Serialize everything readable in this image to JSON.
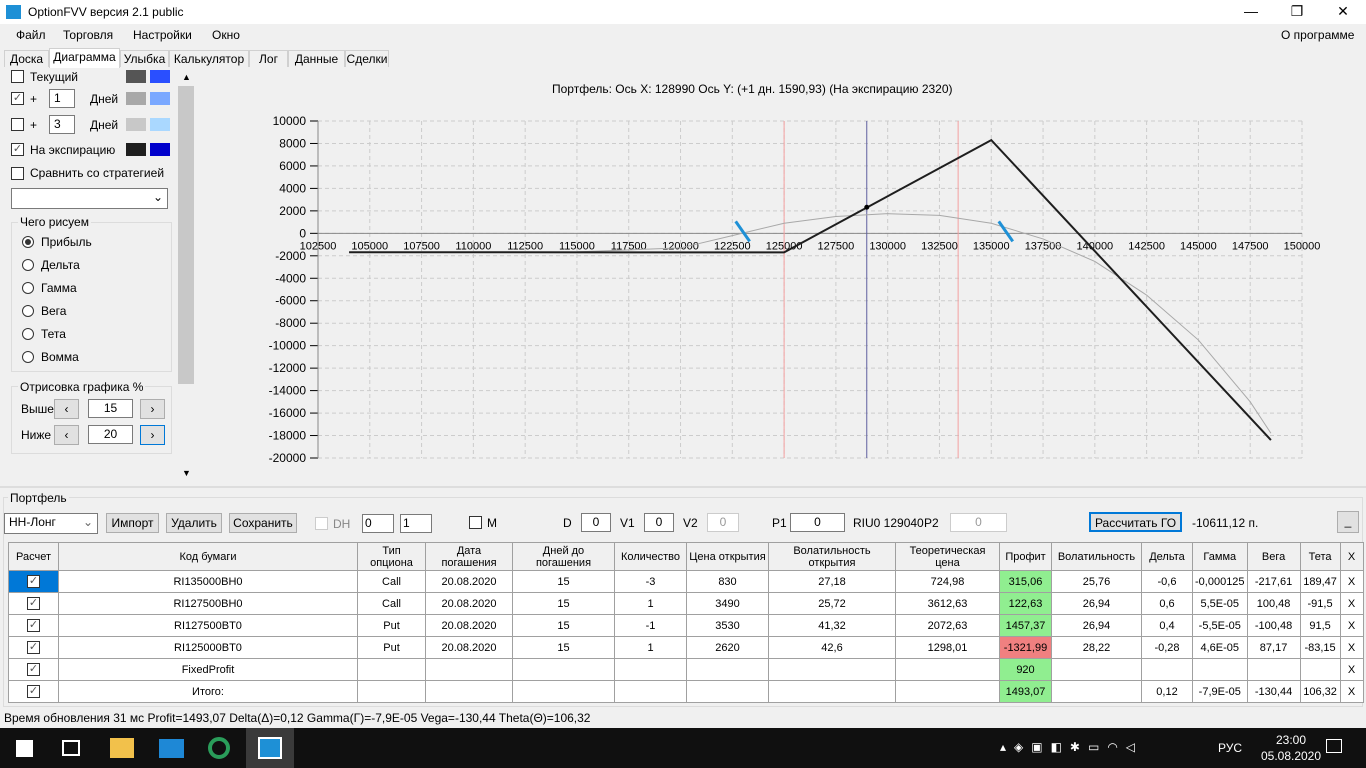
{
  "window": {
    "title": "OptionFVV версия 2.1 public",
    "minimize": "—",
    "maximize": "❐",
    "close": "✕"
  },
  "menu": [
    "Файл",
    "Торговля",
    "Настройки",
    "Окно"
  ],
  "menu_about": "О программе",
  "tabs": [
    "Доска",
    "Диаграмма",
    "Улыбка",
    "Калькулятор",
    "Лог",
    "Данные",
    "Сделки"
  ],
  "active_tab": "Диаграмма",
  "left": {
    "rows": [
      {
        "label": "Текущий",
        "checked": false,
        "c1": "#555555",
        "c2": "#2a4fff"
      },
      {
        "label": "+",
        "days": "1",
        "days_label": "Дней",
        "checked": true,
        "c1": "#a8a8a8",
        "c2": "#7aa8ff"
      },
      {
        "label": "+",
        "days": "3",
        "days_label": "Дней",
        "checked": false,
        "c1": "#c8c8c8",
        "c2": "#aad8ff"
      },
      {
        "label": "На экспирацию",
        "checked": true,
        "c1": "#1e1e1e",
        "c2": "#0000cc"
      }
    ],
    "compare": "Сравнить со стратегией",
    "draw_group": "Чего рисуем",
    "radios": [
      "Прибыль",
      "Дельта",
      "Гамма",
      "Вега",
      "Тета",
      "Вомма"
    ],
    "radio_selected": "Прибыль",
    "range_group": "Отрисовка графика %",
    "above_label": "Выше",
    "above": "15",
    "below_label": "Ниже",
    "below": "20"
  },
  "chart_data": {
    "type": "line",
    "title": "Портфель: Ось X: 128990 Ось Y:  (+1 дн. 1590,93)  (На экспирацию 2320)",
    "xlim": [
      102500,
      150000
    ],
    "ylim": [
      -20000,
      10000
    ],
    "xticks": [
      102500,
      105000,
      107500,
      110000,
      112500,
      115000,
      117500,
      120000,
      122500,
      125000,
      127500,
      130000,
      132500,
      135000,
      137500,
      140000,
      142500,
      145000,
      147500,
      150000
    ],
    "yticks": [
      10000,
      8000,
      6000,
      4000,
      2000,
      0,
      -2000,
      -4000,
      -6000,
      -8000,
      -10000,
      -12000,
      -14000,
      -16000,
      -18000,
      -20000
    ],
    "grid": true,
    "crosshair_x": 128990,
    "red_lines": [
      125000,
      133400
    ],
    "blue_marks": [
      123000,
      135700
    ],
    "series": [
      {
        "color": "#a8a8a8",
        "x": [
          104000,
          115000,
          120000,
          122500,
          125000,
          127500,
          130000,
          132500,
          135000,
          137500,
          140000,
          142500,
          145000,
          147500,
          148500
        ],
        "y": [
          -1700,
          -1650,
          -1300,
          -200,
          900,
          1500,
          1750,
          1600,
          900,
          -500,
          -2500,
          -5500,
          -9500,
          -15000,
          -17800
        ]
      },
      {
        "color": "#1e1e1e",
        "x": [
          104000,
          125000,
          135000,
          148500
        ],
        "y": [
          -1680,
          -1700,
          8300,
          -18400
        ]
      }
    ],
    "point": {
      "x": 128990,
      "y": 2320
    }
  },
  "portfolio": {
    "group": "Портфель",
    "strategy": "НН-Лонг",
    "import": "Импорт",
    "delete": "Удалить",
    "save": "Сохранить",
    "dh": "DH",
    "spin1": "0",
    "spin2": "1",
    "m": "M",
    "d_label": "D",
    "d": "0",
    "v1_label": "V1",
    "v1": "0",
    "v2_label": "V2",
    "v2": "0",
    "p1_label": "P1",
    "p1": "0",
    "riu": "RIU0 129040",
    "p2_label": "P2",
    "p2": "0",
    "calc_go": "Рассчитать ГО",
    "go_value": "-10611,12 п.",
    "minimize": "_"
  },
  "table": {
    "headers": [
      "Расчет",
      "Код бумаги",
      "Тип опциона",
      "Дата погашения",
      "Дней до погашения",
      "Количество",
      "Цена открытия",
      "Волатильность открытия",
      "Теоретическая цена",
      "Профит",
      "Волатильность",
      "Дельта",
      "Гамма",
      "Вега",
      "Тета",
      "X"
    ],
    "rows": [
      [
        "RI135000BH0",
        "Call",
        "20.08.2020",
        "15",
        "-3",
        "830",
        "27,18",
        "724,98",
        "315,06",
        "25,76",
        "-0,6",
        "-0,000125",
        "-217,61",
        "189,47",
        "X"
      ],
      [
        "RI127500BH0",
        "Call",
        "20.08.2020",
        "15",
        "1",
        "3490",
        "25,72",
        "3612,63",
        "122,63",
        "26,94",
        "0,6",
        "5,5E-05",
        "100,48",
        "-91,5",
        "X"
      ],
      [
        "RI127500BT0",
        "Put",
        "20.08.2020",
        "15",
        "-1",
        "3530",
        "41,32",
        "2072,63",
        "1457,37",
        "26,94",
        "0,4",
        "-5,5E-05",
        "-100,48",
        "91,5",
        "X"
      ],
      [
        "RI125000BT0",
        "Put",
        "20.08.2020",
        "15",
        "1",
        "2620",
        "42,6",
        "1298,01",
        "-1321,99",
        "28,22",
        "-0,28",
        "4,6E-05",
        "87,17",
        "-83,15",
        "X"
      ],
      [
        "FixedProfit",
        "",
        "",
        "",
        "",
        "",
        "",
        "",
        "920",
        "",
        "",
        "",
        "",
        "",
        "X"
      ],
      [
        "Итого:",
        "",
        "",
        "",
        "",
        "",
        "",
        "",
        "1493,07",
        "",
        "0,12",
        "-7,9E-05",
        "-130,44",
        "106,32",
        "X"
      ]
    ]
  },
  "status": "Время обновления 31 мс  Profit=1493,07 Delta(Δ)=0,12 Gamma(Γ)=-7,9E-05 Vega=-130,44 Theta(Θ)=106,32",
  "taskbar": {
    "lang": "РУС",
    "time": "23:00",
    "date": "05.08.2020"
  }
}
